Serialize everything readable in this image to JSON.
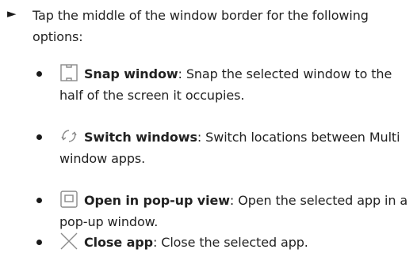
{
  "main": {
    "arrow_glyph": "►",
    "text": "Tap the middle of the window border for the following options:"
  },
  "options": [
    {
      "icon": "snap-window-icon",
      "title": "Snap window",
      "sep": ": ",
      "description": "Snap the selected window to the half of the screen it occupies."
    },
    {
      "icon": "switch-windows-icon",
      "title": "Switch windows",
      "sep": ": ",
      "description": "Switch locations between Multi window apps."
    },
    {
      "icon": "popup-view-icon",
      "title": "Open in pop-up view",
      "sep": ": ",
      "description": "Open the selected app in a pop-up window."
    },
    {
      "icon": "close-icon",
      "title": "Close app",
      "sep": ": ",
      "description": "Close the selected app."
    }
  ],
  "colors": {
    "text": "#222222",
    "icon_stroke": "#8a8a8a"
  }
}
